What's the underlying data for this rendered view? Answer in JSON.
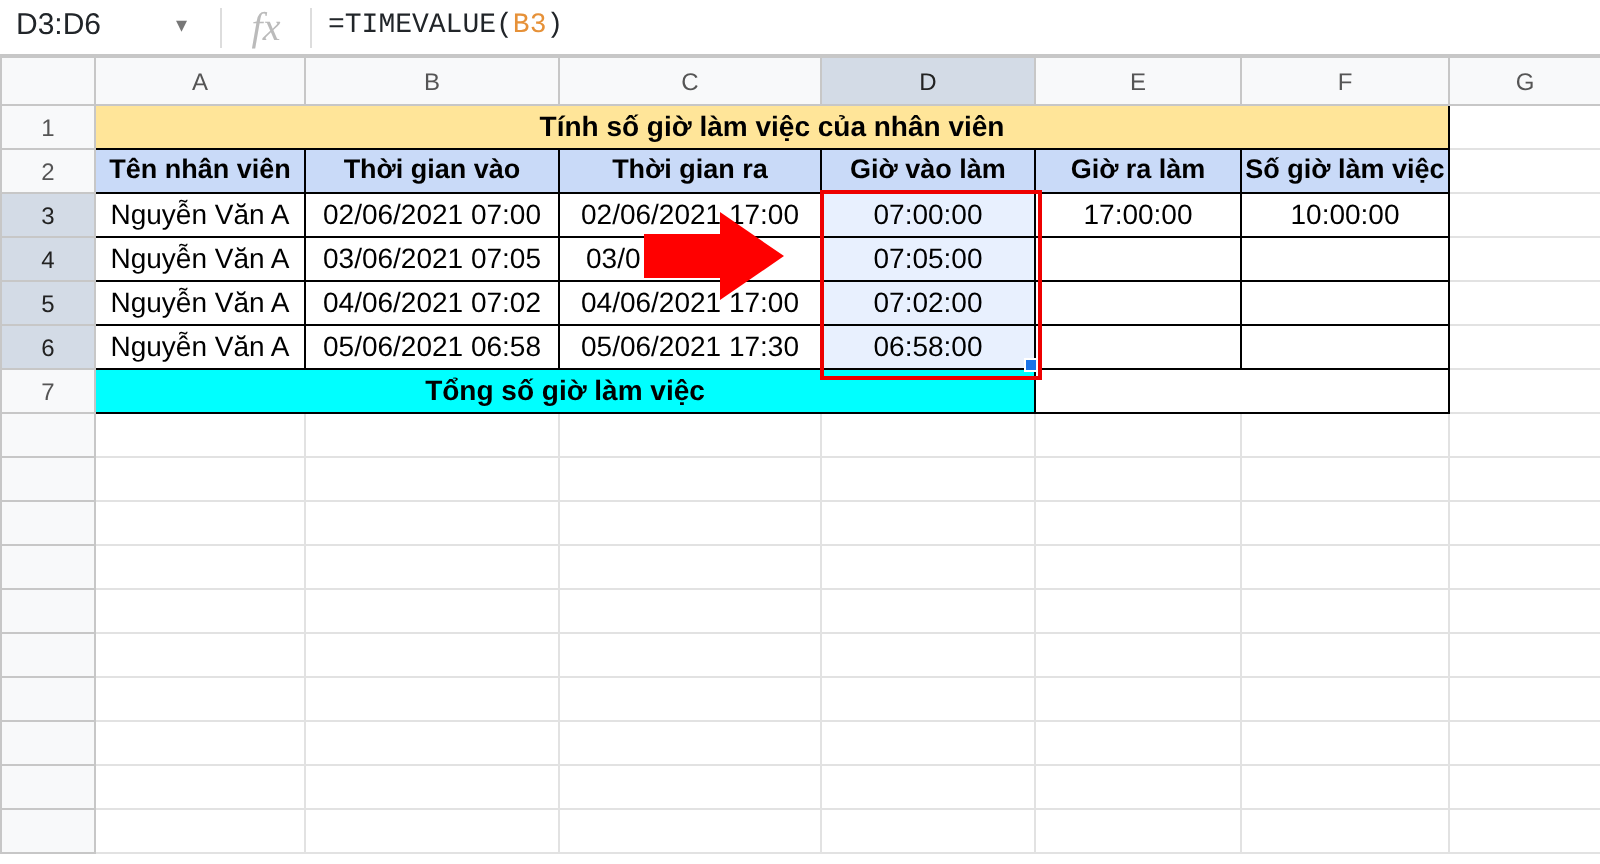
{
  "formula_bar": {
    "cell_ref": "D3:D6",
    "dropdown": "▾",
    "fx": "fx",
    "formula": [
      {
        "text": "=TIMEVALUE(",
        "kind": "plain"
      },
      {
        "text": "B3",
        "kind": "ref"
      },
      {
        "text": ")",
        "kind": "plain"
      }
    ]
  },
  "columns": [
    {
      "label": "A",
      "selected": false
    },
    {
      "label": "B",
      "selected": false
    },
    {
      "label": "C",
      "selected": false
    },
    {
      "label": "D",
      "selected": true
    },
    {
      "label": "E",
      "selected": false
    },
    {
      "label": "F",
      "selected": false
    },
    {
      "label": "G",
      "selected": false
    }
  ],
  "rows": [
    {
      "number": "1",
      "selected": false,
      "cells": [
        {
          "text": "Tính số giờ làm việc của nhân viên",
          "kind": "title",
          "selected": false
        }
      ]
    },
    {
      "number": "2",
      "selected": false,
      "cells": [
        {
          "text": "Tên nhân viên",
          "kind": "header",
          "selected": false
        },
        {
          "text": "Thời gian vào",
          "kind": "header",
          "selected": false
        },
        {
          "text": "Thời gian ra",
          "kind": "header",
          "selected": false
        },
        {
          "text": "Giờ vào làm",
          "kind": "header",
          "selected": false
        },
        {
          "text": "Giờ ra làm",
          "kind": "header",
          "selected": false
        },
        {
          "text": "Số giờ làm việc",
          "kind": "header",
          "selected": false
        }
      ]
    },
    {
      "number": "3",
      "selected": true,
      "cells": [
        {
          "text": "Nguyễn Văn A",
          "kind": "data",
          "selected": false
        },
        {
          "text": "02/06/2021 07:00",
          "kind": "data",
          "selected": false
        },
        {
          "text": "02/06/2021 17:00",
          "kind": "data",
          "selected": false
        },
        {
          "text": "07:00:00",
          "kind": "data",
          "selected": true
        },
        {
          "text": "17:00:00",
          "kind": "data",
          "selected": false
        },
        {
          "text": "10:00:00",
          "kind": "data",
          "selected": false
        }
      ]
    },
    {
      "number": "4",
      "selected": true,
      "cells": [
        {
          "text": "Nguyễn Văn A",
          "kind": "data",
          "selected": false
        },
        {
          "text": "03/06/2021 07:05",
          "kind": "data",
          "selected": false
        },
        {
          "text": "03/0",
          "kind": "covered",
          "selected": false
        },
        {
          "text": "07:05:00",
          "kind": "data",
          "selected": true
        },
        {
          "text": "",
          "kind": "data",
          "selected": false
        },
        {
          "text": "",
          "kind": "data",
          "selected": false
        }
      ]
    },
    {
      "number": "5",
      "selected": true,
      "cells": [
        {
          "text": "Nguyễn Văn A",
          "kind": "data",
          "selected": false
        },
        {
          "text": "04/06/2021 07:02",
          "kind": "data",
          "selected": false
        },
        {
          "text": "04/06/2021 17:00",
          "kind": "data",
          "selected": false
        },
        {
          "text": "07:02:00",
          "kind": "data",
          "selected": true
        },
        {
          "text": "",
          "kind": "data",
          "selected": false
        },
        {
          "text": "",
          "kind": "data",
          "selected": false
        }
      ]
    },
    {
      "number": "6",
      "selected": true,
      "cells": [
        {
          "text": "Nguyễn Văn A",
          "kind": "data",
          "selected": false
        },
        {
          "text": "05/06/2021 06:58",
          "kind": "data",
          "selected": false
        },
        {
          "text": "05/06/2021 17:30",
          "kind": "data",
          "selected": false
        },
        {
          "text": "06:58:00",
          "kind": "data",
          "selected": true
        },
        {
          "text": "",
          "kind": "data",
          "selected": false
        },
        {
          "text": "",
          "kind": "data",
          "selected": false
        }
      ]
    },
    {
      "number": "7",
      "selected": false,
      "cells": [
        {
          "text": "Tổng số giờ làm việc",
          "kind": "total",
          "selected": false
        },
        {
          "text": "",
          "kind": "merged",
          "selected": false
        }
      ]
    }
  ]
}
